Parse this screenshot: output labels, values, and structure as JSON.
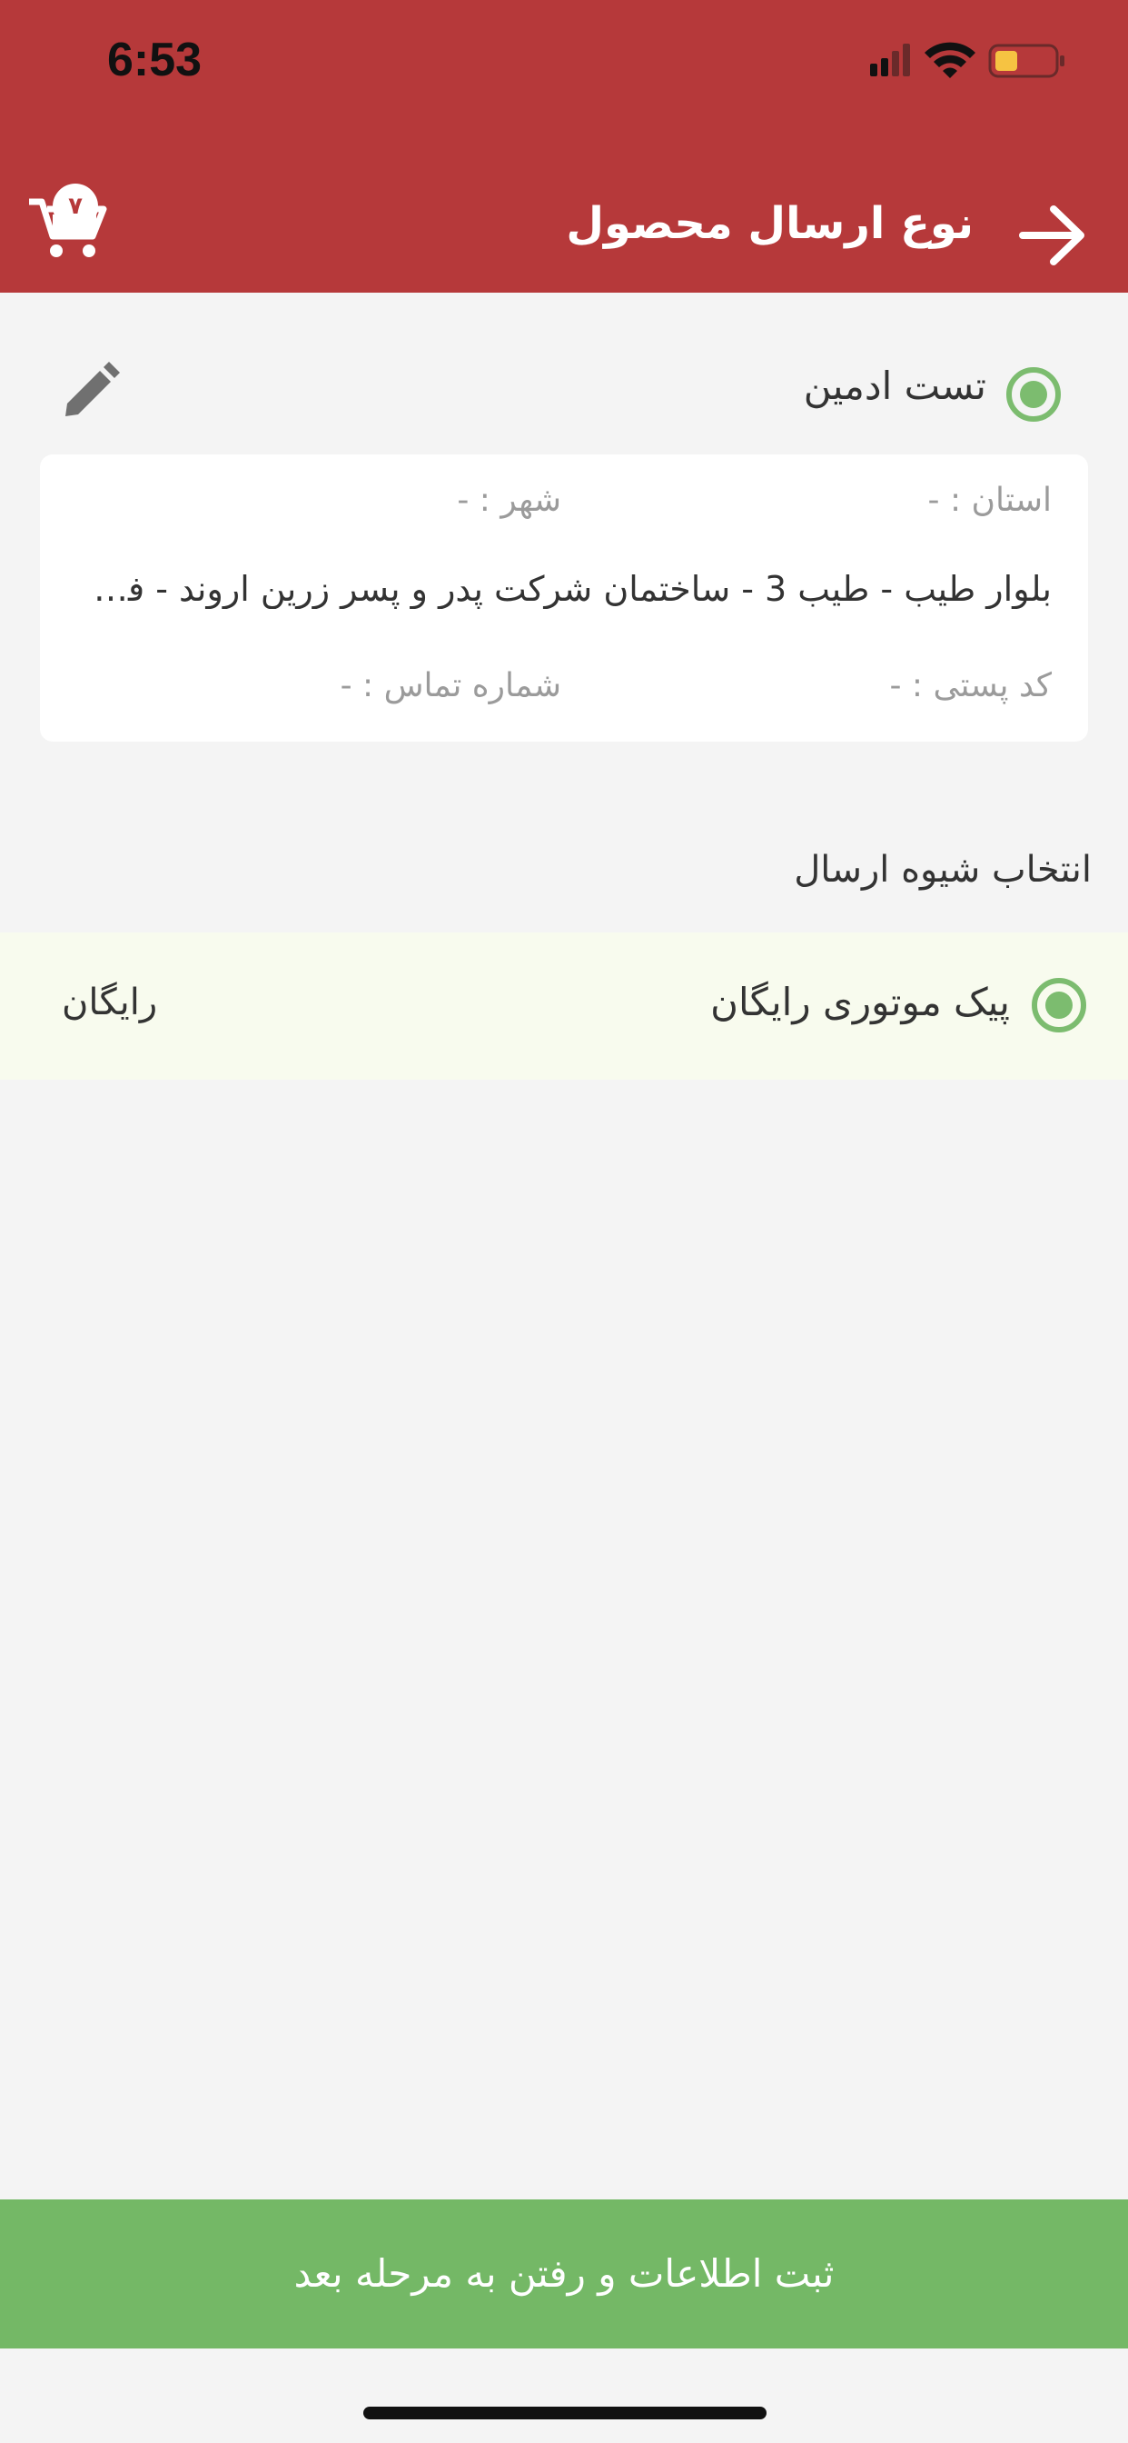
{
  "status_bar": {
    "time": "6:53",
    "icons": [
      "signal-icon",
      "wifi-icon",
      "battery-icon"
    ]
  },
  "header": {
    "title": "نوع ارسال محصول",
    "cart_count": "۷",
    "back_icon": "arrow-right-icon",
    "cart_icon": "cart-icon"
  },
  "address": {
    "name": "تست ادمین",
    "selected": true,
    "province_label": "استان : -",
    "city_label": "شهر : -",
    "address_line": "بلوار طیب - طیب 3 - ساختمان شرکت پدر و پسر زرین اروند - فروشگاه",
    "postal_label": "کد پستی : -",
    "phone_label": "شماره تماس : -"
  },
  "shipping": {
    "section_title": "انتخاب شیوه ارسال",
    "methods": [
      {
        "name": "پیک موتوری رایگان",
        "price": "رایگان",
        "selected": true
      }
    ]
  },
  "footer": {
    "submit_label": "ثبت اطلاعات و رفتن به مرحله بعد"
  },
  "colors": {
    "header": "#b6393a",
    "accent_green": "#74b866",
    "radio_green": "#7cbc6f",
    "method_bg": "#f8fbee",
    "background": "#f4f4f4"
  }
}
